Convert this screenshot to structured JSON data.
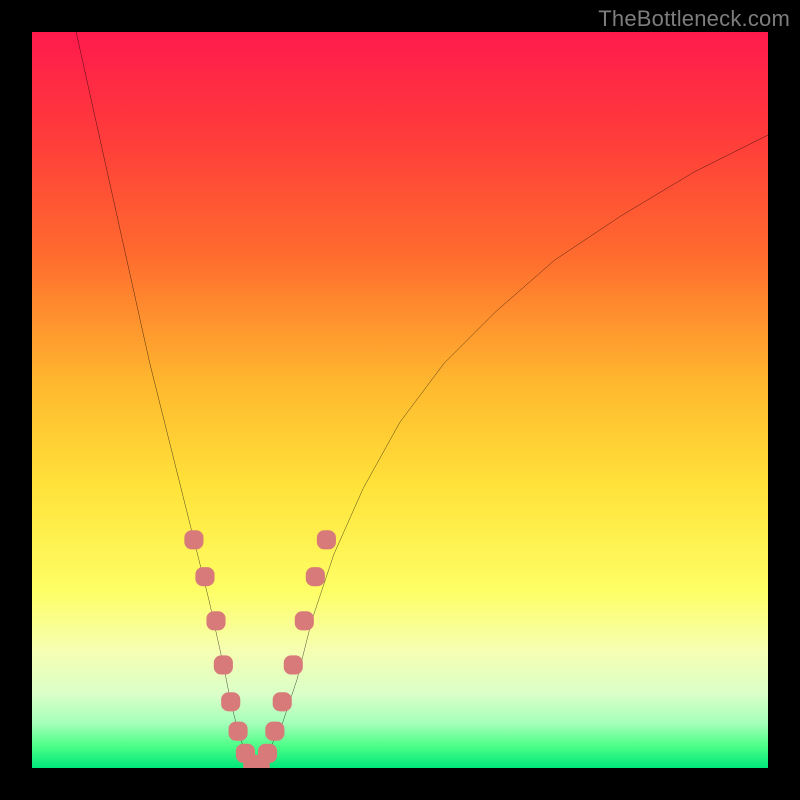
{
  "watermark": {
    "text": "TheBottleneck.com"
  },
  "colors": {
    "background": "#000000",
    "curve": "#000000",
    "marker_fill": "#d97a7a",
    "gradient_stops": [
      "#ff1a4d",
      "#ff3b3b",
      "#ff6a2e",
      "#ffb92e",
      "#ffe33a",
      "#feff66",
      "#f6ffb2",
      "#daffc8",
      "#a3ffb8",
      "#4dff88",
      "#00e67a"
    ]
  },
  "chart_data": {
    "type": "line",
    "title": "",
    "xlabel": "",
    "ylabel": "",
    "xlim": [
      0,
      100
    ],
    "ylim": [
      0,
      100
    ],
    "grid": false,
    "legend": false,
    "series": [
      {
        "name": "bottleneck-curve",
        "x": [
          6,
          8,
          10,
          12,
          14,
          16,
          18,
          20,
          22,
          24,
          26,
          27,
          28,
          29,
          30,
          31,
          32,
          34,
          36,
          38,
          41,
          45,
          50,
          56,
          63,
          71,
          80,
          90,
          100
        ],
        "y": [
          100,
          91,
          82,
          73,
          64,
          55,
          47,
          39,
          31,
          23,
          14,
          9,
          5,
          2,
          0.5,
          0.5,
          2,
          6,
          12,
          20,
          29,
          38,
          47,
          55,
          62,
          69,
          75,
          81,
          86
        ]
      }
    ],
    "markers": {
      "name": "highlighted-points",
      "shape": "rounded-square",
      "x": [
        22,
        23.5,
        25,
        26,
        27,
        28,
        29,
        30,
        31,
        32,
        33,
        34,
        35.5,
        37,
        38.5,
        40
      ],
      "y": [
        31,
        26,
        20,
        14,
        9,
        5,
        2,
        0.5,
        0.5,
        2,
        5,
        9,
        14,
        20,
        26,
        31
      ]
    }
  }
}
